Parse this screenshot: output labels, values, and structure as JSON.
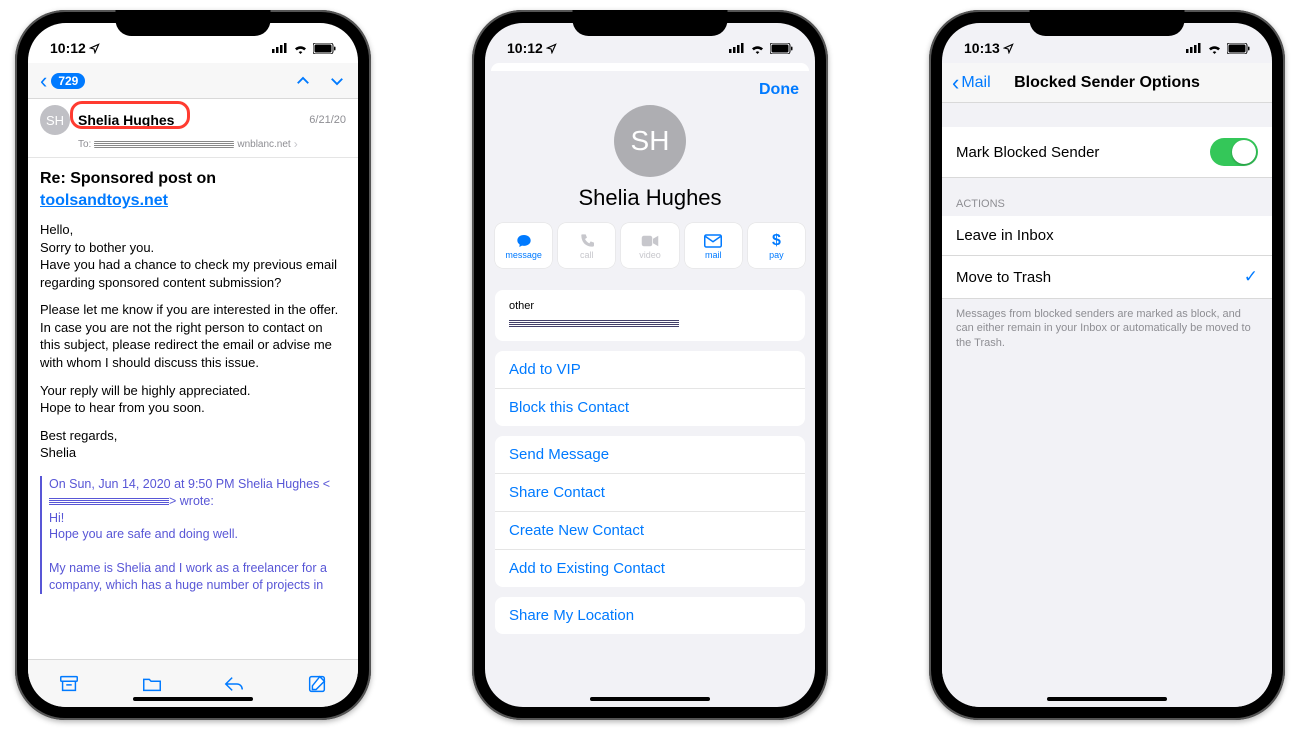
{
  "phone1": {
    "time": "10:12",
    "badge": "729",
    "sender": "Shelia Hughes",
    "initials": "SH",
    "date": "6/21/20",
    "to_prefix": "To:",
    "to_domain": "wnblanc.net",
    "subject_prefix": "Re: Sponsored post on",
    "subject_link": "toolsandtoys.net",
    "p1": "Hello,\nSorry to bother you.\nHave you had a chance to check my previous email regarding sponsored content submission?",
    "p2": "Please let me know if you are interested in the offer.\nIn case you are not the right person to contact on this subject, please redirect the email or advise me with whom I should discuss this issue.",
    "p3": "Your reply will be highly appreciated.\nHope to hear from you soon.",
    "p4": "Best regards,\nShelia",
    "q_head": "On Sun, Jun 14, 2020 at 9:50 PM Shelia Hughes <",
    "q_head2": "> wrote:",
    "q_l1": "Hi!",
    "q_l2": "Hope you are safe and doing well.",
    "q_l3": "My name is Shelia and I work as a freelancer for a company, which has a huge number of projects in"
  },
  "phone2": {
    "time": "10:12",
    "done": "Done",
    "initials": "SH",
    "name": "Shelia Hughes",
    "actions": [
      {
        "label": "message",
        "enabled": true
      },
      {
        "label": "call",
        "enabled": false
      },
      {
        "label": "video",
        "enabled": false
      },
      {
        "label": "mail",
        "enabled": true
      },
      {
        "label": "pay",
        "enabled": true
      }
    ],
    "other_label": "other",
    "cells1": [
      "Add to VIP",
      "Block this Contact"
    ],
    "cells2": [
      "Send Message",
      "Share Contact",
      "Create New Contact",
      "Add to Existing Contact"
    ],
    "cells3": [
      "Share My Location"
    ]
  },
  "phone3": {
    "time": "10:13",
    "back": "Mail",
    "title": "Blocked Sender Options",
    "mark_label": "Mark Blocked Sender",
    "mark_on": true,
    "actions_header": "ACTIONS",
    "opt1": "Leave in Inbox",
    "opt2": "Move to Trash",
    "opt2_checked": true,
    "footer": "Messages from blocked senders are marked as block, and can either remain in your Inbox or automatically be moved to the Trash."
  }
}
